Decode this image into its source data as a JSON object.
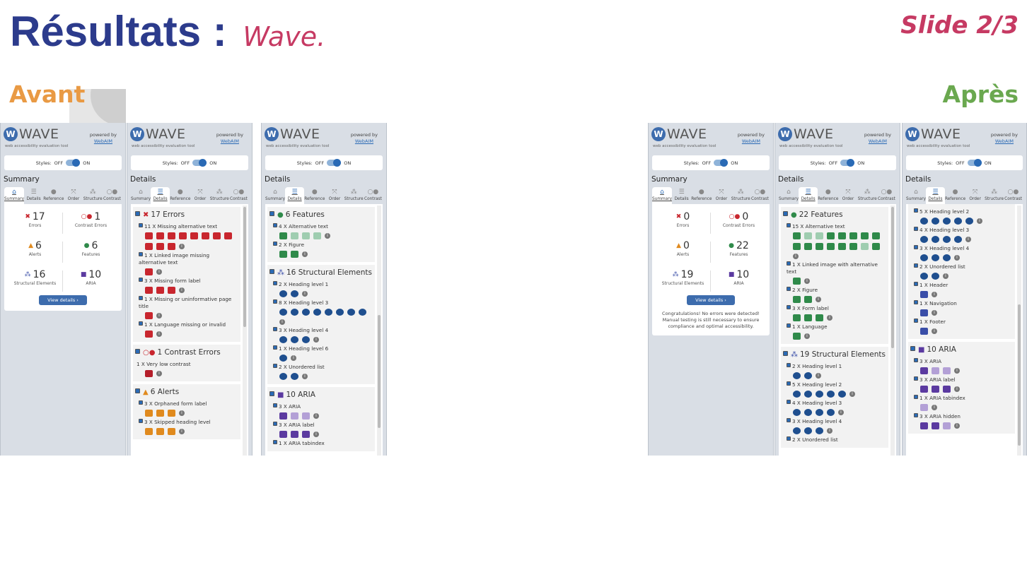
{
  "title": "Résultats :",
  "subtitle": "Wave.",
  "slide": "Slide 2/3",
  "before": "Avant",
  "after": "Après",
  "colors": {
    "title": "#2c3b8c",
    "accent": "#c63a63",
    "before": "#e99a44",
    "after": "#6aa84f"
  },
  "wave": {
    "logo": "W",
    "name": "WAVE",
    "tagline": "web accessibility evaluation tool",
    "powered": "powered by",
    "webaim": "WebAIM",
    "styles": "Styles:",
    "off": "OFF",
    "on": "ON",
    "summary": "Summary",
    "details": "Details",
    "view": "View details ›"
  },
  "tabs": [
    "Summary",
    "Details",
    "Reference",
    "Order",
    "Structure",
    "Contrast"
  ],
  "cap": {
    "errors": "Errors",
    "contrast": "Contrast Errors",
    "alerts": "Alerts",
    "features": "Features",
    "structural": "Structural Elements",
    "aria": "ARIA"
  },
  "s1": {
    "errors": "17",
    "contrast": "1",
    "alerts": "6",
    "features": "6",
    "structural": "16",
    "aria": "10"
  },
  "s2": {
    "errors": "0",
    "contrast": "0",
    "alerts": "0",
    "features": "22",
    "structural": "19",
    "aria": "10",
    "congrats": "Congratulations! No errors were detected! Manual testing is still necessary to ensure compliance and optimal accessibility."
  },
  "p2": {
    "h_errors": "17 Errors",
    "e1": "11 X Missing alternative text",
    "e2": "1 X Linked image missing alternative text",
    "e3": "3 X Missing form label",
    "e4": "1 X Missing or uninformative page title",
    "e5": "1 X Language missing or invalid",
    "h_contrast": "1 Contrast Errors",
    "c1": "1 X Very low contrast",
    "h_alerts": "6 Alerts",
    "a1": "3 X Orphaned form label",
    "a2": "3 X Skipped heading level"
  },
  "p3": {
    "h_features": "6 Features",
    "f1": "4 X Alternative text",
    "f2": "2 X Figure",
    "h_struct": "16 Structural Elements",
    "s1": "2 X Heading level 1",
    "s2": "8 X Heading level 3",
    "s3": "3 X Heading level 4",
    "s4": "1 X Heading level 6",
    "s5": "2 X Unordered list",
    "h_aria": "10 ARIA",
    "r1": "3 X ARIA",
    "r2": "3 X ARIA label",
    "r3": "1 X ARIA tabindex"
  },
  "p5": {
    "h_features": "22 Features",
    "f1": "15 X Alternative text",
    "f2": "1 X Linked image with alternative text",
    "f3": "2 X Figure",
    "f4": "3 X Form label",
    "f5": "1 X Language",
    "h_struct": "19 Structural Elements",
    "s1": "2 X Heading level 1",
    "s2": "5 X Heading level 2",
    "s3": "4 X Heading level 3",
    "s4": "3 X Heading level 4",
    "s5": "2 X Unordered list"
  },
  "p6": {
    "s1": "5 X Heading level 2",
    "s2": "4 X Heading level 3",
    "s3": "3 X Heading level 4",
    "s4": "2 X Unordered list",
    "s5": "1 X Header",
    "s6": "1 X Navigation",
    "s7": "1 X Footer",
    "h_aria": "10 ARIA",
    "r1": "3 X ARIA",
    "r2": "3 X ARIA label",
    "r3": "1 X ARIA tabindex",
    "r4": "3 X ARIA hidden"
  }
}
